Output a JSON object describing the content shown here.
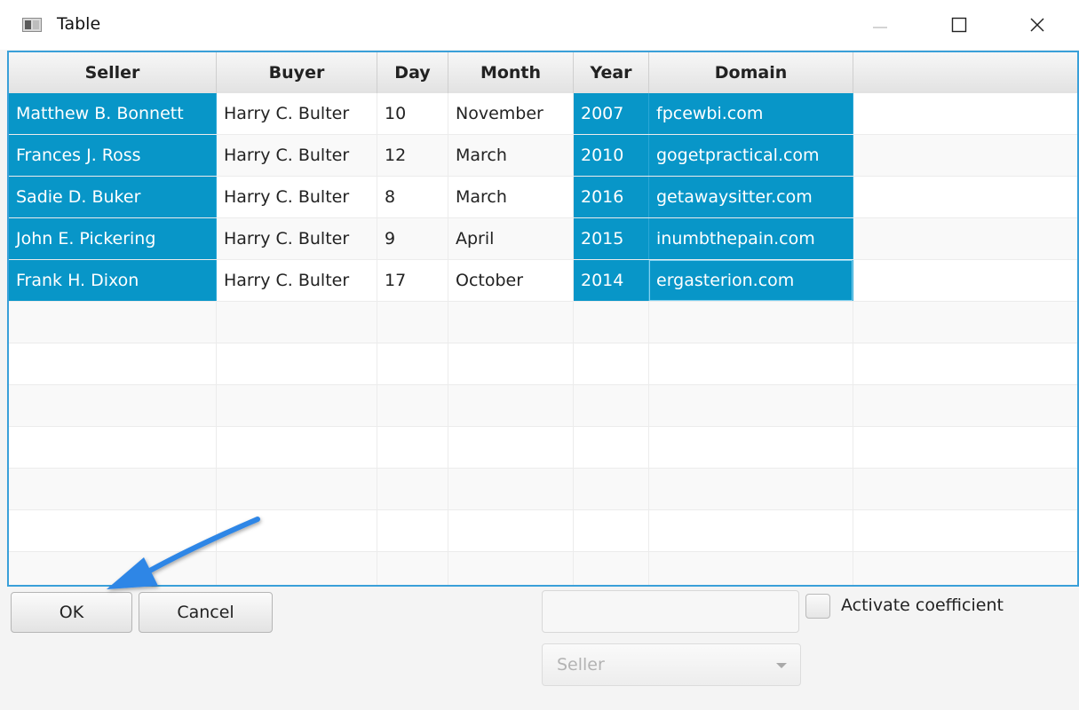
{
  "window": {
    "title": "Table"
  },
  "table": {
    "columns": [
      "Seller",
      "Buyer",
      "Day",
      "Month",
      "Year",
      "Domain"
    ],
    "rows": [
      {
        "seller": "Matthew B. Bonnett",
        "buyer": "Harry C. Bulter",
        "day": "10",
        "month": "November",
        "year": "2007",
        "domain": "fpcewbi.com"
      },
      {
        "seller": "Frances J. Ross",
        "buyer": "Harry C. Bulter",
        "day": "12",
        "month": "March",
        "year": "2010",
        "domain": "gogetpractical.com"
      },
      {
        "seller": "Sadie D. Buker",
        "buyer": "Harry C. Bulter",
        "day": "8",
        "month": "March",
        "year": "2016",
        "domain": "getawaysitter.com"
      },
      {
        "seller": "John E. Pickering",
        "buyer": "Harry C. Bulter",
        "day": "9",
        "month": "April",
        "year": "2015",
        "domain": "inumbthepain.com"
      },
      {
        "seller": "Frank H. Dixon",
        "buyer": "Harry C. Bulter",
        "day": "17",
        "month": "October",
        "year": "2014",
        "domain": "ergasterion.com"
      }
    ],
    "selected_columns": [
      "Seller",
      "Year",
      "Domain"
    ],
    "selection_color": "#0896c8",
    "border_color": "#3aa0d9"
  },
  "buttons": {
    "ok_label": "OK",
    "cancel_label": "Cancel"
  },
  "coefficient": {
    "input_value": "",
    "checkbox_label": "Activate coefficient",
    "checked": false
  },
  "column_select": {
    "value": "Seller"
  },
  "icons": {
    "app": "table-app-icon",
    "minimize": "minimize-icon",
    "maximize": "maximize-icon",
    "close": "close-icon",
    "dropdown": "chevron-down-icon"
  },
  "annotation": {
    "arrow_color": "#2f86e6"
  }
}
